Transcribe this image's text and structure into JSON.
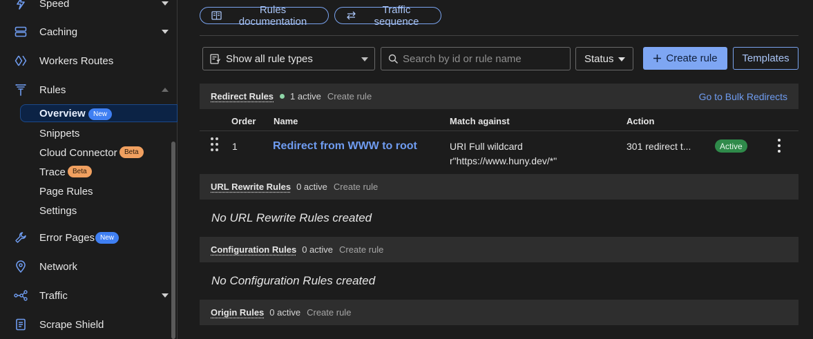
{
  "sidebar": {
    "items": [
      {
        "label": "Speed",
        "icon": "lightning-icon"
      },
      {
        "label": "Caching",
        "icon": "storage-icon"
      },
      {
        "label": "Workers Routes",
        "icon": "workers-icon"
      },
      {
        "label": "Rules",
        "icon": "rules-funnel-icon"
      },
      {
        "label": "Error Pages",
        "icon": "wrench-icon",
        "badge": "New"
      },
      {
        "label": "Network",
        "icon": "location-pin-icon"
      },
      {
        "label": "Traffic",
        "icon": "traffic-nodes-icon"
      },
      {
        "label": "Scrape Shield",
        "icon": "document-shield-icon"
      }
    ],
    "rules_sub": [
      {
        "label": "Overview",
        "badge": "New"
      },
      {
        "label": "Snippets"
      },
      {
        "label": "Cloud Connector",
        "badge": "Beta"
      },
      {
        "label": "Trace",
        "badge": "Beta"
      },
      {
        "label": "Page Rules"
      },
      {
        "label": "Settings"
      }
    ]
  },
  "header": {
    "docs_label": "Rules documentation",
    "sequence_label": "Traffic sequence"
  },
  "toolbar": {
    "rule_type_select": "Show all rule types",
    "search_placeholder": "Search by id or rule name",
    "status_label": "Status",
    "create_label": "Create rule",
    "templates_label": "Templates"
  },
  "sections": {
    "redirect": {
      "title": "Redirect Rules",
      "count": "1 active",
      "create": "Create rule",
      "bulk": "Go to Bulk Redirects"
    },
    "rewrite": {
      "title": "URL Rewrite Rules",
      "count": "0 active",
      "create": "Create rule",
      "empty": "No URL Rewrite Rules created"
    },
    "config": {
      "title": "Configuration Rules",
      "count": "0 active",
      "create": "Create rule",
      "empty": "No Configuration Rules created"
    },
    "origin": {
      "title": "Origin Rules",
      "count": "0 active",
      "create": "Create rule"
    }
  },
  "table": {
    "headers": [
      "Order",
      "Name",
      "Match against",
      "Action"
    ],
    "rows": [
      {
        "order": "1",
        "name": "Redirect from WWW to root",
        "match_line1": "URI Full wildcard",
        "match_line2": "r\"https://www.huny.dev/*\"",
        "action": "301 redirect t...",
        "status": "Active"
      }
    ]
  },
  "colors": {
    "accent": "#6f9cf0",
    "active_green": "#2f8a4a",
    "new_badge": "#3f7ff2",
    "beta_badge": "#f0a060"
  }
}
